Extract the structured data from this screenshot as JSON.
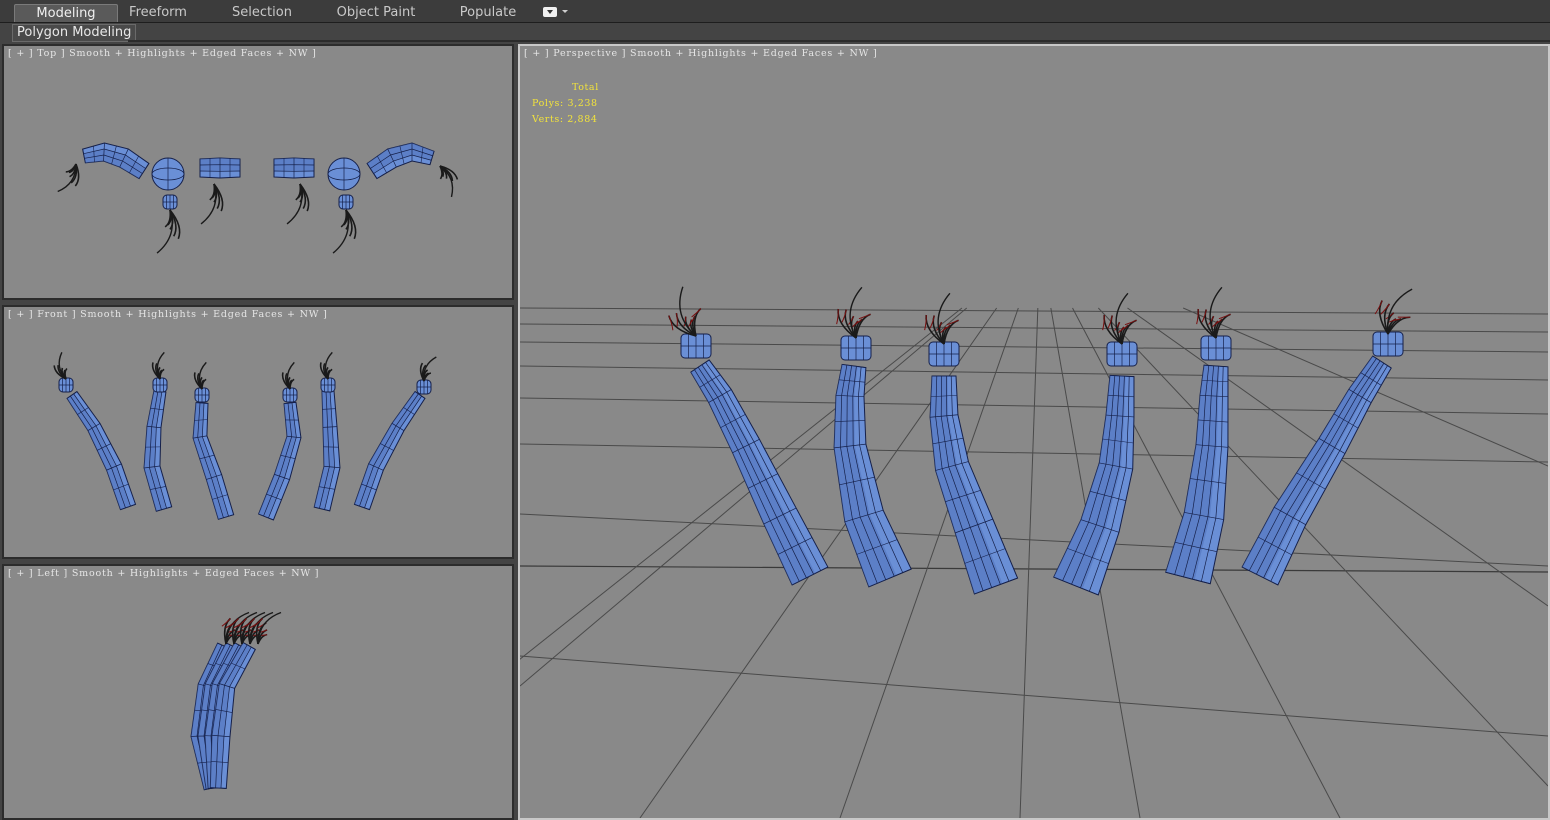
{
  "ribbon": {
    "tabs": [
      {
        "label": "Modeling",
        "active": true
      },
      {
        "label": "Freeform",
        "active": false
      },
      {
        "label": "Selection",
        "active": false
      },
      {
        "label": "Object Paint",
        "active": false
      },
      {
        "label": "Populate",
        "active": false
      }
    ],
    "menu_icon": "dropdown-box-icon"
  },
  "subbar": {
    "label": "Polygon Modeling"
  },
  "viewports": {
    "top": {
      "label": "[ + ] Top ] Smooth + Highlights + Edged Faces + NW ]"
    },
    "front": {
      "label": "[ + ] Front ] Smooth + Highlights + Edged Faces + NW ]"
    },
    "left": {
      "label": "[ + ] Left ] Smooth + Highlights + Edged Faces + NW ]"
    },
    "perspective": {
      "label": "[ + ] Perspective ] Smooth + Highlights + Edged Faces + NW ]",
      "stats": {
        "header": "Total",
        "polys_label": "Polys:",
        "polys": "3,238",
        "verts_label": "Verts:",
        "verts": "2,884"
      }
    }
  },
  "colors": {
    "viewport_bg": "#898989",
    "mesh_fill": "#6a8fd6",
    "mesh_edge": "#15204a",
    "claw": "#1a1a1a",
    "claw_tip": "#7a1010",
    "stats_text": "#f2e33b",
    "grid_line": "#4a4a4a"
  },
  "objects": {
    "model_description": "six creature arm meshes with claws"
  }
}
